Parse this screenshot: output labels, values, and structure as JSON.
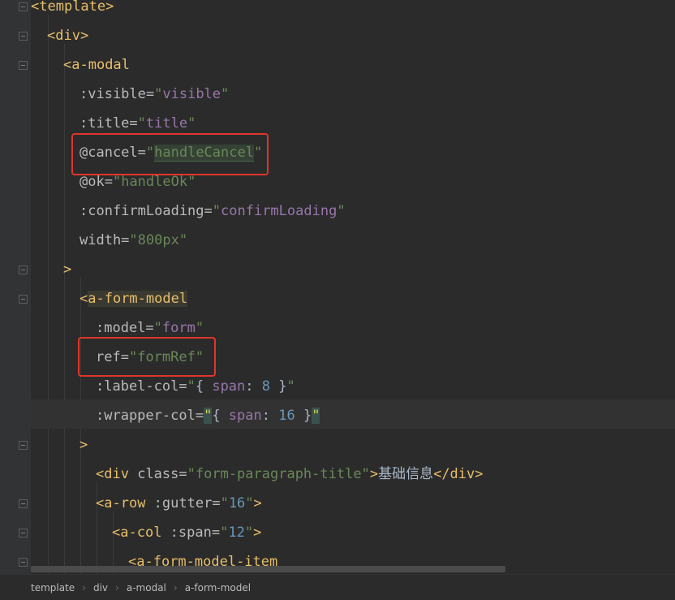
{
  "editor": {
    "lines": {
      "l1": {
        "open": "<",
        "tag": "template",
        "close": ">"
      },
      "l2": {
        "open": "<",
        "tag": "div",
        "close": ">"
      },
      "l3": {
        "open": "<",
        "tag": "a-modal"
      },
      "l4": {
        "attr": ":visible=",
        "q1": "\"",
        "val": "visible",
        "q2": "\""
      },
      "l5": {
        "attr": ":title=",
        "q1": "\"",
        "val": "title",
        "q2": "\""
      },
      "l6": {
        "attr": "@cancel=",
        "q1": "\"",
        "val": "handleCancel",
        "q2": "\""
      },
      "l7": {
        "attr": "@ok=",
        "q1": "\"",
        "val": "handleOk",
        "q2": "\""
      },
      "l8": {
        "attr": ":confirmLoading=",
        "q1": "\"",
        "val": "confirmLoading",
        "q2": "\""
      },
      "l9": {
        "attr": "width=",
        "q1": "\"",
        "val": "800px",
        "q2": "\""
      },
      "l10": {
        "close": ">"
      },
      "l11": {
        "open": "<",
        "tag": "a-form-model"
      },
      "l12": {
        "attr": ":model=",
        "q1": "\"",
        "val": "form",
        "q2": "\""
      },
      "l13": {
        "attr": "ref=",
        "q1": "\"",
        "val": "formRef",
        "q2": "\""
      },
      "l14": {
        "attr": ":label-col=",
        "q1": "\"",
        "b1": "{ ",
        "key": "span",
        "colon": ": ",
        "num": "8",
        "b2": " }",
        "q2": "\""
      },
      "l15": {
        "attr": ":wrapper-col=",
        "q1": "\"",
        "b1": "{ ",
        "key": "span",
        "colon": ": ",
        "num": "16",
        "b2": " }",
        "q2": "\""
      },
      "l16": {
        "close": ">"
      },
      "l17": {
        "open": "<",
        "tag": "div",
        "attr": " class=",
        "q1": "\"",
        "val": "form-paragraph-title",
        "q2": "\"",
        "gt": ">",
        "text": "基础信息",
        "endtag": "</div>"
      },
      "l18": {
        "open": "<",
        "tag": "a-row",
        "attr": " :gutter=",
        "q1": "\"",
        "val": "16",
        "q2": "\"",
        "gt": ">"
      },
      "l19": {
        "open": "<",
        "tag": "a-col",
        "attr": " :span=",
        "q1": "\"",
        "val": "12",
        "q2": "\"",
        "gt": ">"
      },
      "l20": {
        "open": "<",
        "tag": "a-form-model-item"
      }
    }
  },
  "breadcrumb": {
    "items": [
      "template",
      "div",
      "a-modal",
      "a-form-model"
    ],
    "separator": "›"
  },
  "colors": {
    "background": "#2b2b2b",
    "tag": "#e8bf6a",
    "string": "#6a8759",
    "highlight_box": "#e0352b"
  }
}
